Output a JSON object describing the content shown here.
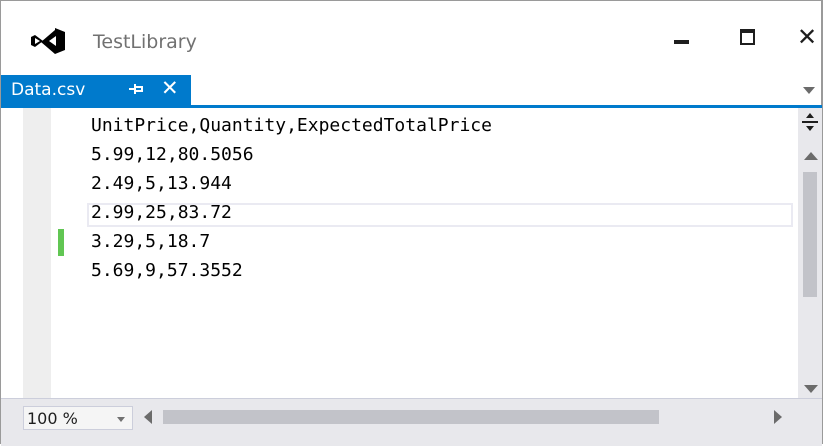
{
  "window": {
    "title": "TestLibrary",
    "logo_icon": "visual-studio-logo-icon",
    "controls": {
      "minimize_icon": "minimize-icon",
      "maximize_icon": "maximize-icon",
      "close_glyph": "✕"
    }
  },
  "tabs": [
    {
      "label": "Data.csv",
      "pin_icon": "pin-icon",
      "close_glyph": "✕",
      "active": true
    }
  ],
  "editor": {
    "lines": [
      "UnitPrice,Quantity,ExpectedTotalPrice",
      "5.99,12,80.5056",
      "2.49,5,13.944",
      "2.99,25,83.72",
      "3.29,5,18.7",
      "5.69,9,57.3552"
    ],
    "current_line_index": 3,
    "changed_line_index": 4
  },
  "statusbar": {
    "zoom": "100 %"
  },
  "colors": {
    "accent": "#007acc",
    "change_marker": "#61c653",
    "scrollbar_thumb": "#c2c3c9"
  }
}
